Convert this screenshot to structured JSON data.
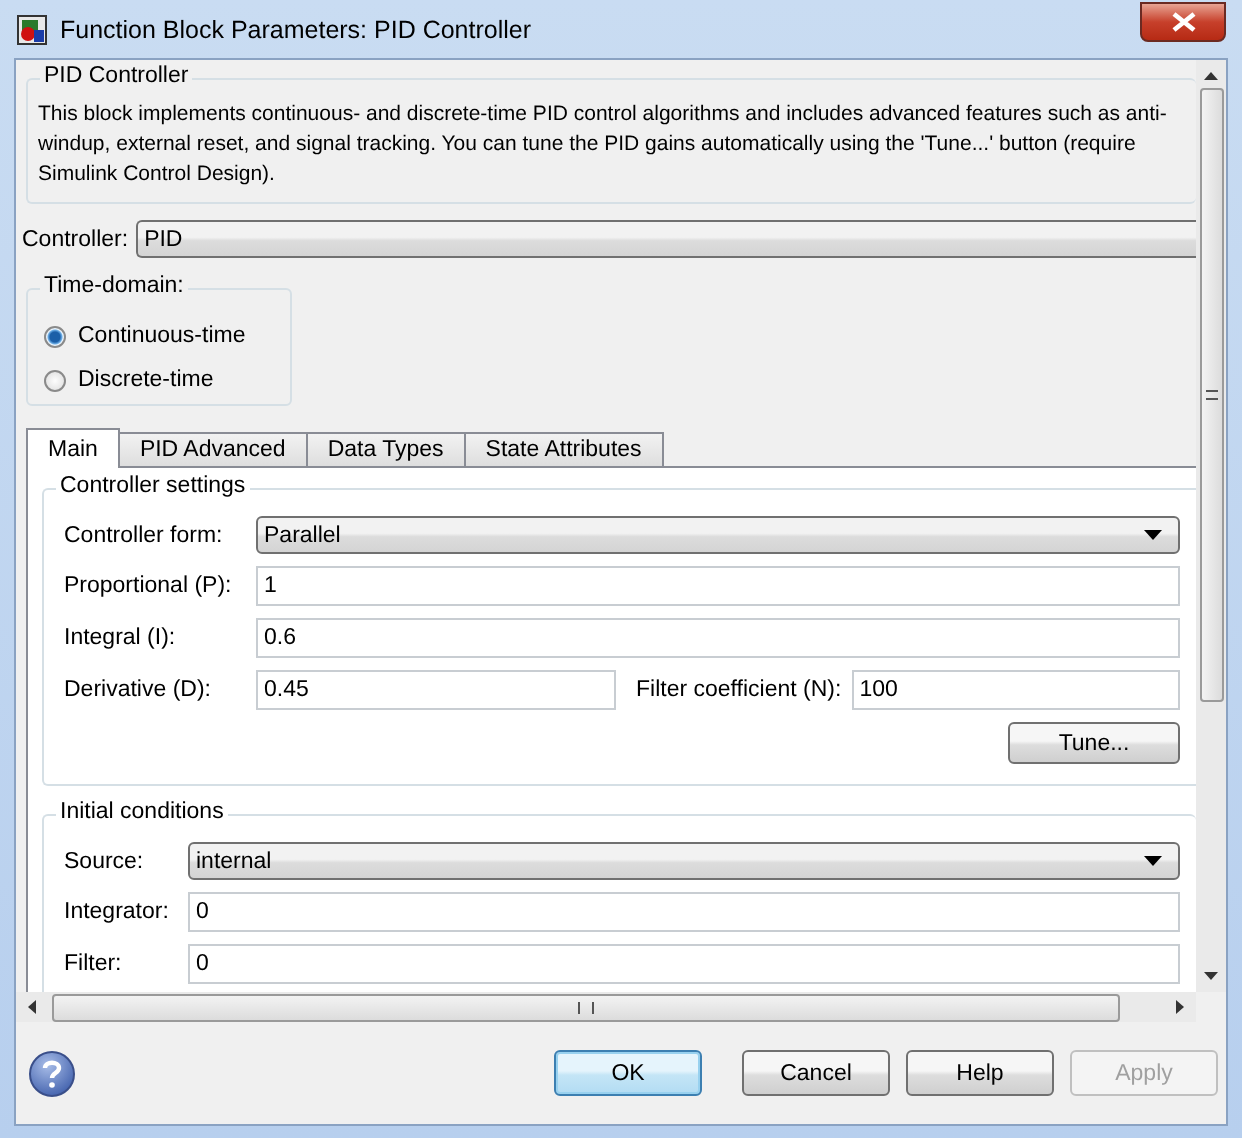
{
  "window": {
    "title": "Function Block Parameters: PID Controller"
  },
  "description": {
    "title": "PID Controller",
    "text": "This block implements continuous- and discrete-time PID control algorithms and includes advanced features such as anti-\nwindup, external reset, and signal tracking. You can tune the PID gains automatically using the 'Tune...' button (require\nSimulink Control Design)."
  },
  "controller": {
    "label": "Controller:",
    "value": "PID"
  },
  "time_domain": {
    "title": "Time-domain:",
    "options": [
      {
        "label": "Continuous-time",
        "selected": true
      },
      {
        "label": "Discrete-time",
        "selected": false
      }
    ]
  },
  "tabs": [
    {
      "label": "Main",
      "selected": true
    },
    {
      "label": "PID Advanced",
      "selected": false
    },
    {
      "label": "Data Types",
      "selected": false
    },
    {
      "label": "State Attributes",
      "selected": false
    }
  ],
  "controller_settings": {
    "title": "Controller settings",
    "rows": [
      {
        "kind": "dropdown",
        "label": "Controller form:",
        "value": "Parallel"
      },
      {
        "kind": "field",
        "label": "Proportional (P):",
        "value": "1"
      },
      {
        "kind": "field",
        "label": "Integral (I):",
        "value": "0.6"
      },
      {
        "kind": "pair",
        "label": "Derivative (D):",
        "value": "0.45",
        "label2": "Filter coefficient (N):",
        "value2": "100"
      }
    ],
    "tune_button": "Tune..."
  },
  "initial_conditions": {
    "title": "Initial conditions",
    "rows": [
      {
        "kind": "dropdown",
        "label": "Source:",
        "value": "internal"
      },
      {
        "kind": "field",
        "label": "Integrator:",
        "value": "0"
      },
      {
        "kind": "field",
        "label": "Filter:",
        "value": "0"
      }
    ]
  },
  "buttons": [
    {
      "label": "OK",
      "kind": "default",
      "disabled": false
    },
    {
      "label": "Cancel",
      "kind": "normal",
      "disabled": false
    },
    {
      "label": "Help",
      "kind": "normal",
      "disabled": false
    },
    {
      "label": "Apply",
      "kind": "normal",
      "disabled": true
    }
  ]
}
